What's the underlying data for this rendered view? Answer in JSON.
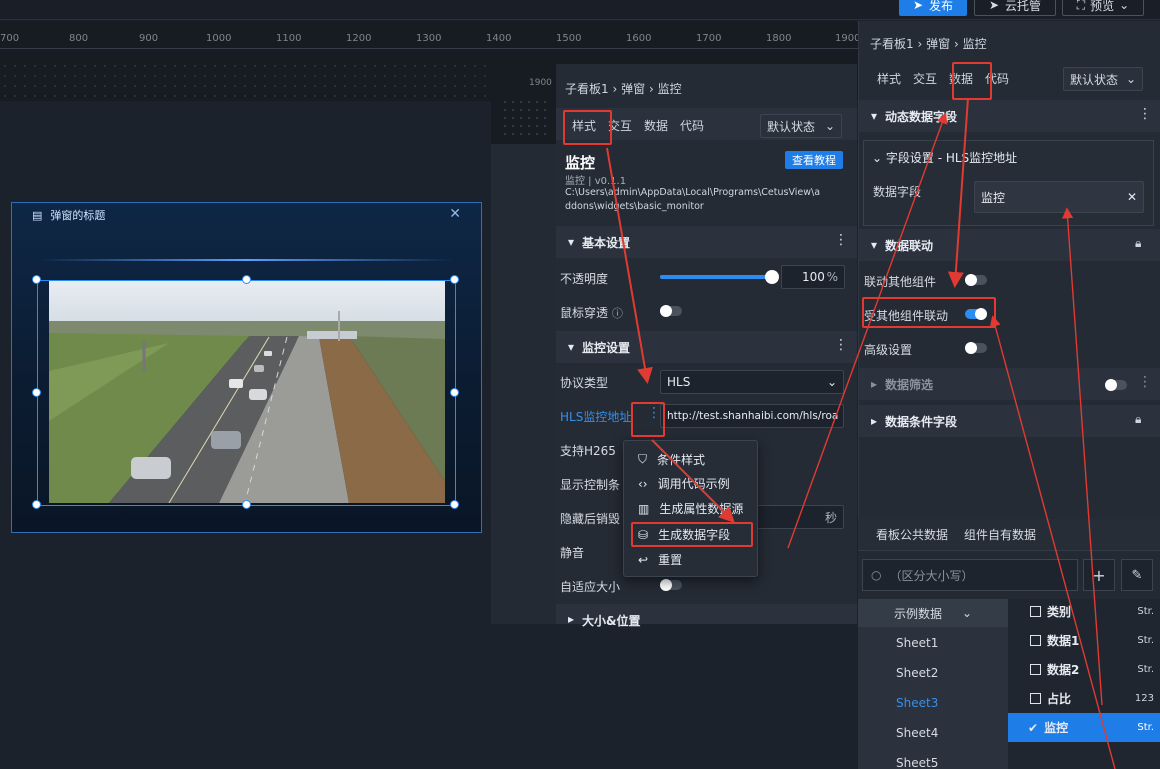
{
  "topbar": {
    "publish": "发布",
    "cloud": "云托管",
    "preview": "预览"
  },
  "ruler": {
    "ticks": [
      "700",
      "800",
      "900",
      "1000",
      "1100",
      "1200",
      "1300",
      "1400",
      "1500",
      "1600",
      "1700",
      "1800",
      "1900"
    ],
    "mini_tick": "1900"
  },
  "popup": {
    "title": "弹窗的标题"
  },
  "mid": {
    "breadcrumb": [
      "子看板1",
      "弹窗",
      "监控"
    ],
    "tabs": [
      "样式",
      "交互",
      "数据",
      "代码"
    ],
    "state": "默认状态",
    "widget_name": "监控",
    "version": "监控 | v0.1.1",
    "path_line1": "C:\\Users\\admin\\AppData\\Local\\Programs\\CetusView\\a",
    "path_line2": "ddons\\widgets\\basic_monitor",
    "tutorial": "查看教程",
    "basic_section": "基本设置",
    "opacity_label": "不透明度",
    "opacity_value": "100",
    "opacity_unit": "%",
    "opacity": 1.0,
    "mouse_label": "鼠标穿透",
    "monitor_section": "监控设置",
    "protocol_label": "协议类型",
    "protocol_value": "HLS",
    "hls_label": "HLS监控地址",
    "hls_value": "http://test.shanhaibi.com/hls/roa",
    "h265_label": "支持H265",
    "controls_label": "显示控制条",
    "hide_label": "隐藏后销毁",
    "sec_unit": "秒",
    "mute_label": "静音",
    "autosize_label": "自适应大小",
    "size_section": "大小&位置"
  },
  "ctx": {
    "items": [
      "条件样式",
      "调用代码示例",
      "生成属性数据源",
      "生成数据字段",
      "重置"
    ]
  },
  "right": {
    "breadcrumb": [
      "子看板1",
      "弹窗",
      "监控"
    ],
    "tabs": [
      "样式",
      "交互",
      "数据",
      "代码"
    ],
    "state": "默认状态",
    "dynamic_section": "动态数据字段",
    "field_setting": "字段设置 - HLS监控地址",
    "data_field_label": "数据字段",
    "data_field_value": "监控",
    "link_section": "数据联动",
    "link_other": "联动其他组件",
    "linked_by": "受其他组件联动",
    "advanced": "高级设置",
    "filter_section": "数据筛选",
    "condition_section": "数据条件字段"
  },
  "bottom": {
    "tabs": [
      "看板公共数据",
      "组件自有数据"
    ],
    "search_placeholder": "（区分大小写）",
    "dataset": "示例数据",
    "sheets": [
      "Sheet1",
      "Sheet2",
      "Sheet3",
      "Sheet4",
      "Sheet5"
    ],
    "fields": [
      {
        "name": "类别",
        "type": "Str."
      },
      {
        "name": "数据1",
        "type": "Str."
      },
      {
        "name": "数据2",
        "type": "Str."
      },
      {
        "name": "占比",
        "type": "123"
      },
      {
        "name": "监控",
        "type": "Str."
      }
    ]
  },
  "colors": {
    "accent": "#2d8cf0",
    "highlight": "#e03a32",
    "panel": "#242b35"
  }
}
